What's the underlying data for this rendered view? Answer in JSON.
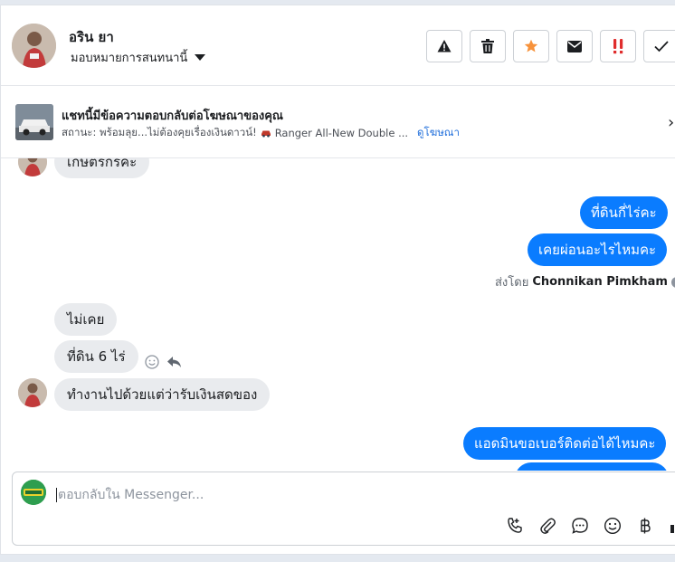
{
  "header": {
    "contact_name": "อริน ยา",
    "assign_label": "มอบหมายการสนทนานี้",
    "actions": [
      {
        "icon": "warning-icon",
        "label": ""
      },
      {
        "icon": "trash-icon",
        "label": ""
      },
      {
        "icon": "star-icon",
        "label": ""
      },
      {
        "icon": "mail-icon",
        "label": ""
      },
      {
        "icon": "spam-icon",
        "label": ""
      },
      {
        "icon": "check-icon",
        "label": ""
      }
    ],
    "colors": {
      "star": "#f7923b",
      "spam": "#e02d2d"
    }
  },
  "ad": {
    "title": "แชทนี้มีข้อความตอบกลับต่อโฆษณาของคุณ",
    "status": "สถานะ: พร้อมลุย...ไม่ต้องคุยเรื่องเงินดาวน์!",
    "ad_name": "Ranger All-New Double ...",
    "link": "ดูโฆษณา"
  },
  "messages": {
    "m1": "เกษตรกรคะ",
    "m2": "ที่ดินกี่ไร่คะ",
    "m3": "เคยผ่อนอะไรไหมคะ",
    "sent_by_label": "ส่งโดย",
    "sent_by_name": "Chonnikan Pimkham",
    "m4": "ไม่เคย",
    "m5": "ที่ดิน 6 ไร่",
    "m6": "ทำงานไปด้วยแต่ว่ารับเงินสดของ",
    "m7": "แอดมินขอเบอร์ติดต่อได้ไหมคะ"
  },
  "composer": {
    "placeholder": "ตอบกลับใน Messenger...",
    "tools": [
      "call-icon",
      "attach-icon",
      "saved-reply-icon",
      "emoji-icon",
      "baht-icon",
      "like-icon"
    ]
  },
  "colors": {
    "outgoing": "#0a7cff",
    "incoming": "#e9ebee"
  }
}
